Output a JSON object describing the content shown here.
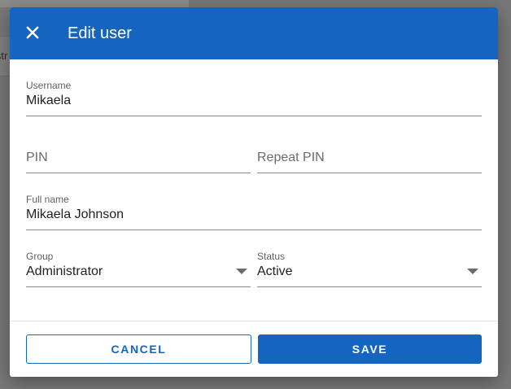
{
  "background": {
    "toolbar_fragment_text": "istr"
  },
  "dialog": {
    "title": "Edit user",
    "close_icon": "close-icon"
  },
  "form": {
    "username": {
      "label": "Username",
      "value": "Mikaela"
    },
    "pin": {
      "placeholder": "PIN"
    },
    "repeat_pin": {
      "placeholder": "Repeat PIN"
    },
    "full_name": {
      "label": "Full name",
      "value": "Mikaela Johnson"
    },
    "group": {
      "label": "Group",
      "value": "Administrator"
    },
    "status": {
      "label": "Status",
      "value": "Active"
    }
  },
  "actions": {
    "cancel_label": "CANCEL",
    "save_label": "SAVE"
  },
  "colors": {
    "primary": "#1565c0",
    "header_text": "#ffffff"
  }
}
